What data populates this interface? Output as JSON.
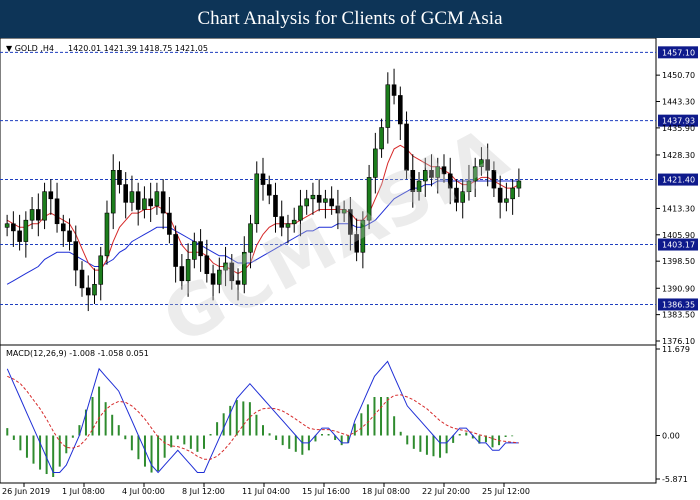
{
  "header": {
    "title": "Chart Analysis for Clients of GCM Asia"
  },
  "watermark": {
    "text": "GCMASIA"
  },
  "chart_data": [
    {
      "type": "candlestick",
      "title": "GOLD ,H4",
      "ohlc_label": "1420.01 1421.39 1418.75 1421.05",
      "ylim": [
        1376.1,
        1460.0
      ],
      "y_ticks": [
        "1450.70",
        "1443.30",
        "1435.90",
        "1428.30",
        "1413.30",
        "1405.90",
        "1398.50",
        "1390.90",
        "1383.50",
        "1376.10"
      ],
      "levels": [
        {
          "label": "1457.10",
          "value": 1457.1,
          "color": "#1f3fbf"
        },
        {
          "label": "1437.93",
          "value": 1437.93,
          "color": "#1f3fbf"
        },
        {
          "label": "1421.40",
          "value": 1421.4,
          "color": "#1f3fbf"
        },
        {
          "label": "1403.17",
          "value": 1403.17,
          "color": "#1f3fbf"
        },
        {
          "label": "1386.35",
          "value": 1386.35,
          "color": "#1f3fbf"
        }
      ],
      "x_labels": [
        "26 Jun 2019",
        "1 Jul 08:00",
        "4 Jul 00:00",
        "8 Jul 12:00",
        "11 Jul 04:00",
        "15 Jul 16:00",
        "18 Jul 08:00",
        "22 Jul 20:00",
        "25 Jul 12:00"
      ],
      "closes": [
        1409,
        1407,
        1404,
        1410,
        1413,
        1410,
        1418,
        1416,
        1409,
        1407,
        1404,
        1396,
        1391,
        1389,
        1392,
        1400,
        1412,
        1424,
        1420,
        1415,
        1418,
        1413,
        1416,
        1414,
        1418,
        1412,
        1406,
        1397,
        1393,
        1399,
        1404,
        1400,
        1395,
        1392,
        1396,
        1398,
        1393,
        1392,
        1401,
        1409,
        1423,
        1420,
        1417,
        1411,
        1408,
        1409,
        1410,
        1414,
        1416,
        1417,
        1415,
        1416,
        1414,
        1412,
        1413,
        1406,
        1401,
        1410,
        1422,
        1430,
        1436,
        1448,
        1445,
        1437,
        1424,
        1418,
        1421,
        1424,
        1422,
        1425,
        1423,
        1419,
        1415,
        1418,
        1421,
        1425,
        1427,
        1424,
        1419,
        1415,
        1416,
        1419,
        1421
      ],
      "ma_fast": [
        1410,
        1409,
        1408,
        1408,
        1409,
        1409,
        1411,
        1412,
        1411,
        1410,
        1409,
        1406,
        1402,
        1398,
        1396,
        1396,
        1399,
        1404,
        1408,
        1410,
        1412,
        1412,
        1413,
        1413,
        1414,
        1413,
        1411,
        1407,
        1403,
        1401,
        1401,
        1401,
        1400,
        1398,
        1397,
        1397,
        1396,
        1395,
        1396,
        1398,
        1403,
        1406,
        1408,
        1409,
        1409,
        1409,
        1409,
        1410,
        1411,
        1412,
        1413,
        1413,
        1413,
        1413,
        1413,
        1412,
        1410,
        1410,
        1412,
        1416,
        1420,
        1426,
        1430,
        1431,
        1430,
        1428,
        1427,
        1426,
        1425,
        1425,
        1424,
        1423,
        1421,
        1420,
        1420,
        1421,
        1422,
        1422,
        1421,
        1420,
        1419,
        1419,
        1420
      ],
      "ma_slow": [
        1392,
        1393,
        1394,
        1395,
        1396,
        1397,
        1399,
        1400,
        1401,
        1401,
        1401,
        1400,
        1399,
        1398,
        1397,
        1397,
        1398,
        1399,
        1401,
        1402,
        1404,
        1405,
        1406,
        1407,
        1408,
        1408,
        1408,
        1407,
        1406,
        1405,
        1404,
        1403,
        1402,
        1401,
        1400,
        1400,
        1399,
        1398,
        1398,
        1398,
        1399,
        1400,
        1401,
        1402,
        1403,
        1404,
        1405,
        1406,
        1407,
        1407,
        1408,
        1408,
        1408,
        1409,
        1409,
        1409,
        1408,
        1408,
        1409,
        1410,
        1412,
        1414,
        1416,
        1417,
        1418,
        1419,
        1419,
        1420,
        1420,
        1421,
        1421,
        1421,
        1421,
        1421,
        1421,
        1421,
        1421,
        1421,
        1421,
        1421,
        1421,
        1421,
        1421
      ]
    },
    {
      "type": "macd",
      "label": "MACD(12,26,9) -1.008 -1.058 0.051",
      "ylim": [
        -5.871,
        11.679
      ],
      "y_ticks": [
        "11.679",
        "0.00",
        "-5.871"
      ],
      "macd": [
        9,
        7,
        5,
        3,
        1,
        -1,
        -3,
        -5,
        -5,
        -4,
        -2,
        0,
        3,
        6,
        9,
        8,
        7,
        6,
        4,
        2,
        0,
        -2,
        -4,
        -5,
        -4,
        -3,
        -2,
        -3,
        -4,
        -5,
        -5,
        -3,
        -1,
        1,
        3,
        5,
        6,
        7,
        6,
        5,
        4,
        3,
        2,
        1,
        0,
        -1,
        -1,
        0,
        1,
        1,
        0,
        -1,
        -1,
        2,
        4,
        6,
        8,
        9,
        10,
        8,
        6,
        4,
        3,
        2,
        1,
        0,
        -1,
        -1,
        0,
        1,
        1,
        0,
        -1,
        -1,
        -2,
        -2,
        -1,
        -1,
        -1
      ],
      "signal": [
        8,
        7.6,
        7,
        6,
        4.8,
        3.6,
        2.2,
        0.6,
        -0.8,
        -1.6,
        -1.7,
        -1.4,
        -0.5,
        0.8,
        2.4,
        3.5,
        4.2,
        4.6,
        4.5,
        4,
        3.2,
        2.2,
        1,
        -0.2,
        -1,
        -1.4,
        -1.5,
        -1.8,
        -2.2,
        -2.8,
        -3.2,
        -3.2,
        -2.8,
        -2,
        -1,
        0.2,
        1.4,
        2.5,
        3.2,
        3.6,
        3.7,
        3.6,
        3.3,
        2.8,
        2.2,
        1.6,
        1,
        0.8,
        0.8,
        0.8,
        0.6,
        0.3,
        0,
        0.4,
        1,
        1.8,
        2.8,
        3.8,
        4.8,
        5.4,
        5.5,
        5.2,
        4.8,
        4.2,
        3.6,
        2.8,
        2,
        1.4,
        1,
        0.8,
        0.6,
        0.4,
        0.1,
        -0.1,
        -0.4,
        -0.7,
        -0.8,
        -0.9,
        -1.0
      ]
    }
  ]
}
